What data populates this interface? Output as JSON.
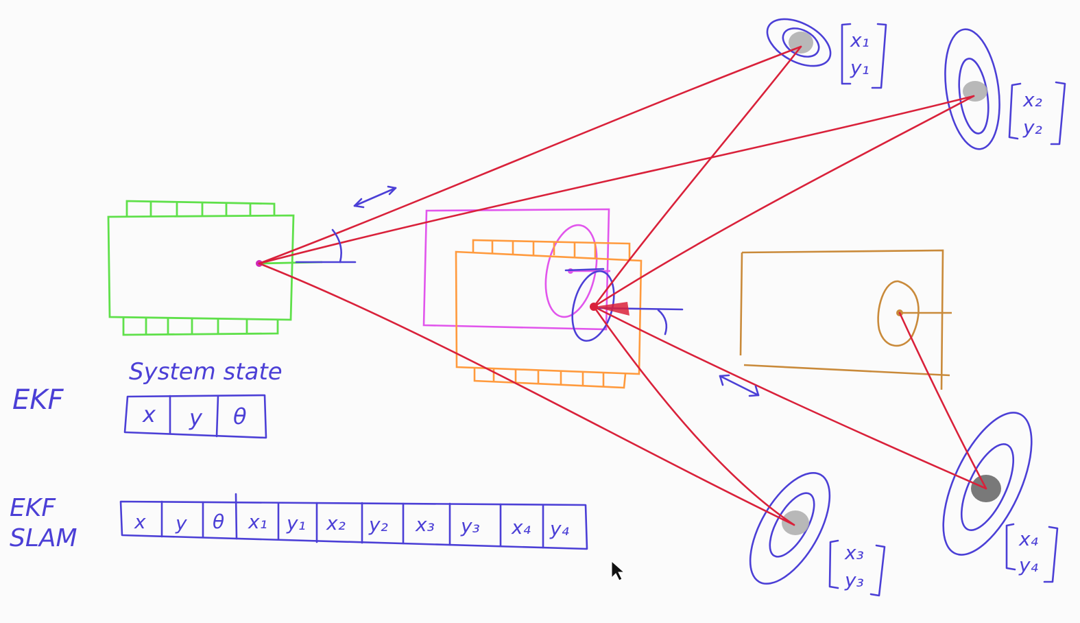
{
  "colors": {
    "ink_blue": "#4b3fd6",
    "ink_red": "#d9213a",
    "robot_green": "#5fe04a",
    "robot_orange": "#ff9a3d",
    "robot_magenta": "#e155ec",
    "robot_brown": "#c98a3a",
    "landmark_gray": "#9a9a9a"
  },
  "labels": {
    "system_state": "System state",
    "ekf": "EKF",
    "ekf_slam_line1": "EKF",
    "ekf_slam_line2": "SLAM"
  },
  "ekf_state": [
    "x",
    "y",
    "θ"
  ],
  "ekf_slam_state": [
    "x",
    "y",
    "θ",
    "x₁",
    "y₁",
    "x₂",
    "y₂",
    "x₃",
    "y₃",
    "x₄",
    "y₄"
  ],
  "landmarks": [
    {
      "x": "x₁",
      "y": "y₁"
    },
    {
      "x": "x₂",
      "y": "y₂"
    },
    {
      "x": "x₃",
      "y": "y₃"
    },
    {
      "x": "x₄",
      "y": "y₄"
    }
  ],
  "icons": {
    "cursor": "mouse-pointer-icon",
    "range_arrow": "double-arrow-icon"
  }
}
